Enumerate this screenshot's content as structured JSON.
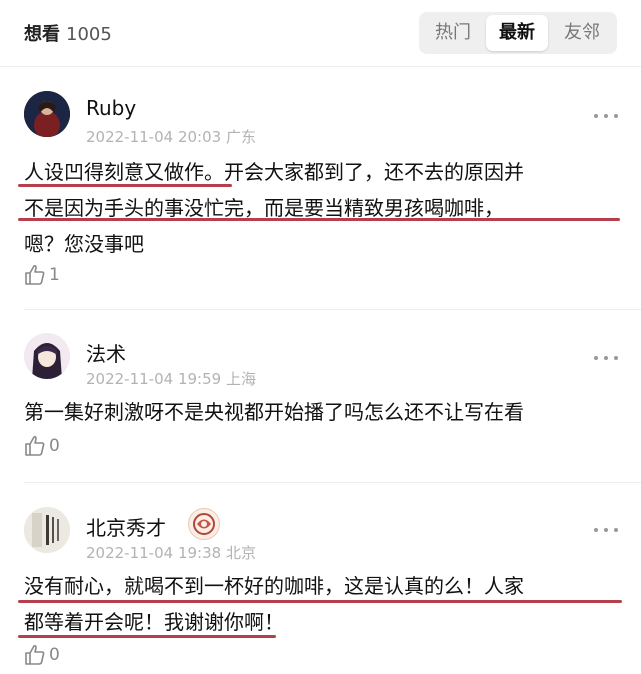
{
  "header": {
    "title": "想看",
    "count": "1005",
    "tabs": [
      {
        "label": "热门",
        "active": false
      },
      {
        "label": "最新",
        "active": true
      },
      {
        "label": "友邻",
        "active": false
      }
    ]
  },
  "comments": [
    {
      "username": "Ruby",
      "date": "2022-11-04 20:03",
      "location": "广东",
      "lines": [
        "人设凹得刻意又做作。开会大家都到了，还不去的原因并",
        "不是因为手头的事没忙完，而是要当精致男孩喝咖啡，",
        "嗯？您没事吧"
      ],
      "likes": "1"
    },
    {
      "username": "法术",
      "date": "2022-11-04 19:59",
      "location": "上海",
      "lines": [
        "第一集好刺激呀不是央视都开始播了吗怎么还不让写在看"
      ],
      "likes": "0"
    },
    {
      "username": "北京秀才",
      "date": "2022-11-04 19:38",
      "location": "北京",
      "lines": [
        "没有耐心，就喝不到一杯好的咖啡，这是认真的么！人家",
        "都等着开会呢！我谢谢你啊！"
      ],
      "likes": "0"
    }
  ],
  "colors": {
    "underline": "#b5404b",
    "meta": "#b3b3b3",
    "accent_text": "#111111"
  },
  "icons": [
    "more-dots-icon",
    "thumbs-up-icon",
    "user-badge-icon"
  ]
}
